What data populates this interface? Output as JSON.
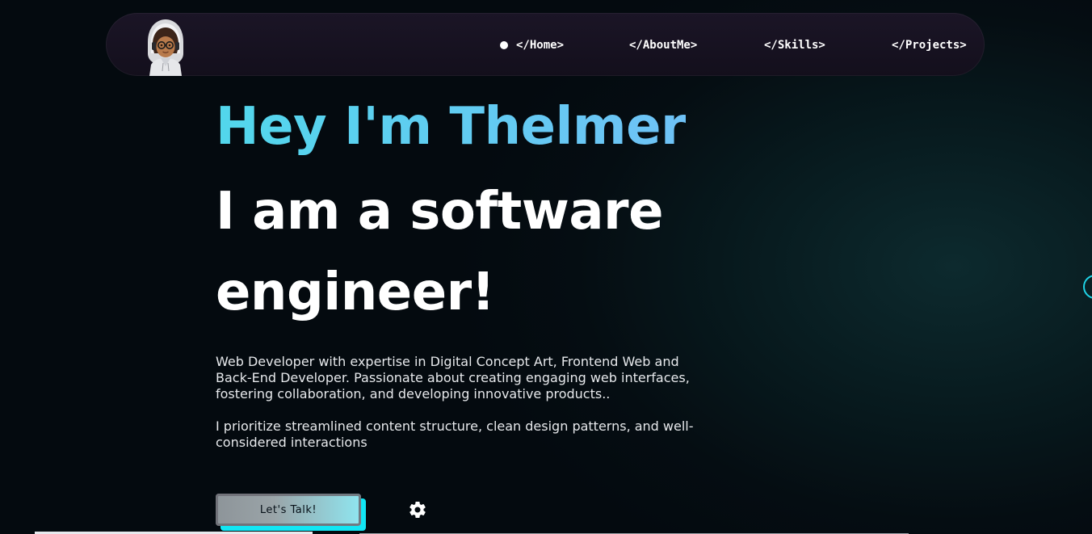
{
  "nav": {
    "avatar_alt": "Thelmer avatar",
    "active_indicator": "dot",
    "items": [
      {
        "label": "</Home>"
      },
      {
        "label": "</AboutMe>"
      },
      {
        "label": "</Skills>"
      },
      {
        "label": "</Projects>"
      }
    ]
  },
  "hero": {
    "greeting": "Hey I'm Thelmer",
    "title": "I am a software engineer!",
    "description_1": "Web Developer with expertise in Digital Concept Art, Frontend Web and Back-End Developer. Passionate about creating engaging web interfaces, fostering collaboration, and developing innovative products..",
    "description_2": "I prioritize streamlined content structure, clean design patterns, and well-considered interactions",
    "cta_label": "Let's Talk!"
  },
  "icons": {
    "settings": "gear-icon",
    "scroll_ring": "circle-icon"
  },
  "colors": {
    "accent_cyan": "#12e6f4",
    "greeting_gradient_start": "#52d7ec",
    "greeting_gradient_end": "#6fc2f6",
    "background": "#050d12",
    "nav_background": "#1b1526"
  }
}
